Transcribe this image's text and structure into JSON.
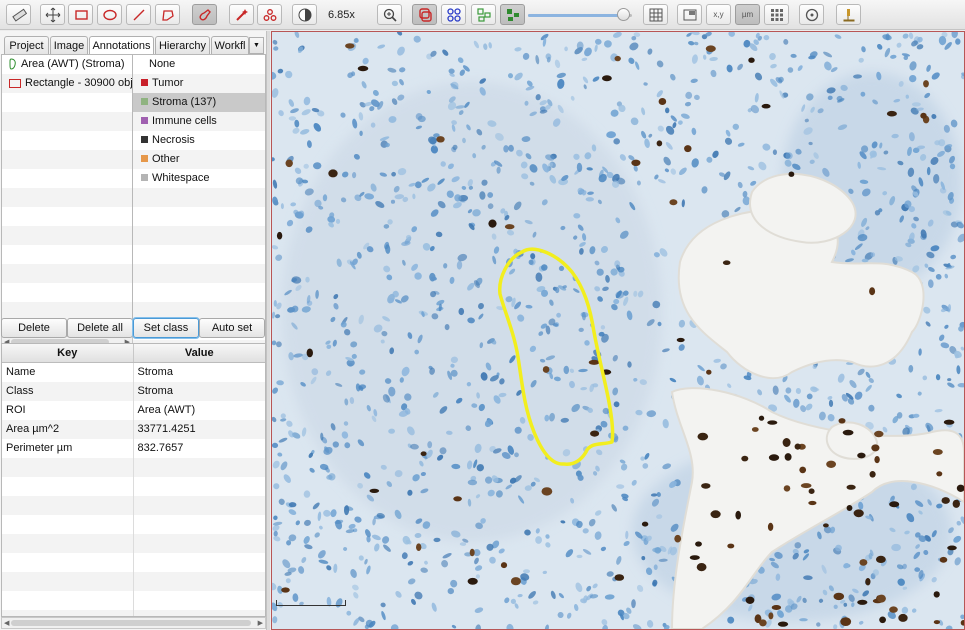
{
  "toolbar": {
    "zoom": "6.85x",
    "opacity_level": 0.92,
    "buttons": [
      {
        "name": "move-tool-icon",
        "kind": "move"
      },
      {
        "name": "rectangle-tool-icon",
        "kind": "rect"
      },
      {
        "name": "ellipse-tool-icon",
        "kind": "ellipse"
      },
      {
        "name": "line-tool-icon",
        "kind": "line"
      },
      {
        "name": "polygon-tool-icon",
        "kind": "polygon"
      },
      {
        "name": "wand-tool-icon",
        "kind": "wand"
      },
      {
        "name": "brush-tool-icon",
        "kind": "brush"
      },
      {
        "name": "points-tool-icon",
        "kind": "points"
      },
      {
        "name": "brightness-contrast-icon",
        "kind": "contrast"
      },
      {
        "name": "zoom-to-fit-icon",
        "kind": "zoomfit"
      },
      {
        "name": "show-annotations-icon",
        "kind": "annot"
      },
      {
        "name": "show-tma-grid-icon",
        "kind": "tma"
      },
      {
        "name": "show-detections-icon",
        "kind": "detect"
      },
      {
        "name": "fill-detections-icon",
        "kind": "filldetect"
      },
      {
        "name": "show-grid-icon",
        "kind": "grid"
      },
      {
        "name": "show-overview-icon",
        "kind": "overview"
      },
      {
        "name": "show-cursor-location-icon",
        "kind": "xy",
        "label": "x,y"
      },
      {
        "name": "show-scalebar-icon",
        "kind": "um",
        "label": "µm"
      },
      {
        "name": "show-counting-grid-icon",
        "kind": "grid2"
      },
      {
        "name": "show-log-icon",
        "kind": "log"
      },
      {
        "name": "microscope-icon",
        "kind": "micro"
      }
    ]
  },
  "tabs": [
    "Project",
    "Image",
    "Annotations",
    "Hierarchy",
    "Workfl"
  ],
  "active_tab": "Annotations",
  "annotations": [
    {
      "label": "Area (AWT) (Stroma)",
      "icon": "area"
    },
    {
      "label": "Rectangle - 30900 obje",
      "icon": "rect"
    }
  ],
  "classes": [
    {
      "name": "None",
      "color": null
    },
    {
      "name": "Tumor",
      "color": "#c8202a"
    },
    {
      "name": "Stroma (137)",
      "color": "#8fb380"
    },
    {
      "name": "Immune cells",
      "color": "#a060b0"
    },
    {
      "name": "Necrosis",
      "color": "#333333"
    },
    {
      "name": "Other",
      "color": "#e6984a"
    },
    {
      "name": "Whitespace",
      "color": "#b4b4b4"
    }
  ],
  "selected_class": "Stroma (137)",
  "buttons": {
    "delete": "Delete",
    "delete_all": "Delete all",
    "set_class": "Set class",
    "auto_set": "Auto set"
  },
  "properties": {
    "header_key": "Key",
    "header_value": "Value",
    "rows": [
      {
        "key": "Name",
        "value": "Stroma"
      },
      {
        "key": "Class",
        "value": "Stroma"
      },
      {
        "key": "ROI",
        "value": "Area (AWT)"
      },
      {
        "key": "Area µm^2",
        "value": "33771.4251"
      },
      {
        "key": "Perimeter µm",
        "value": "832.7657"
      }
    ]
  },
  "viewer": {
    "annotation_color": "#f2ee1e",
    "hematoxylin_color": "#4a86c0",
    "dab_color": "#3a2412",
    "border_color": "#b85656"
  }
}
